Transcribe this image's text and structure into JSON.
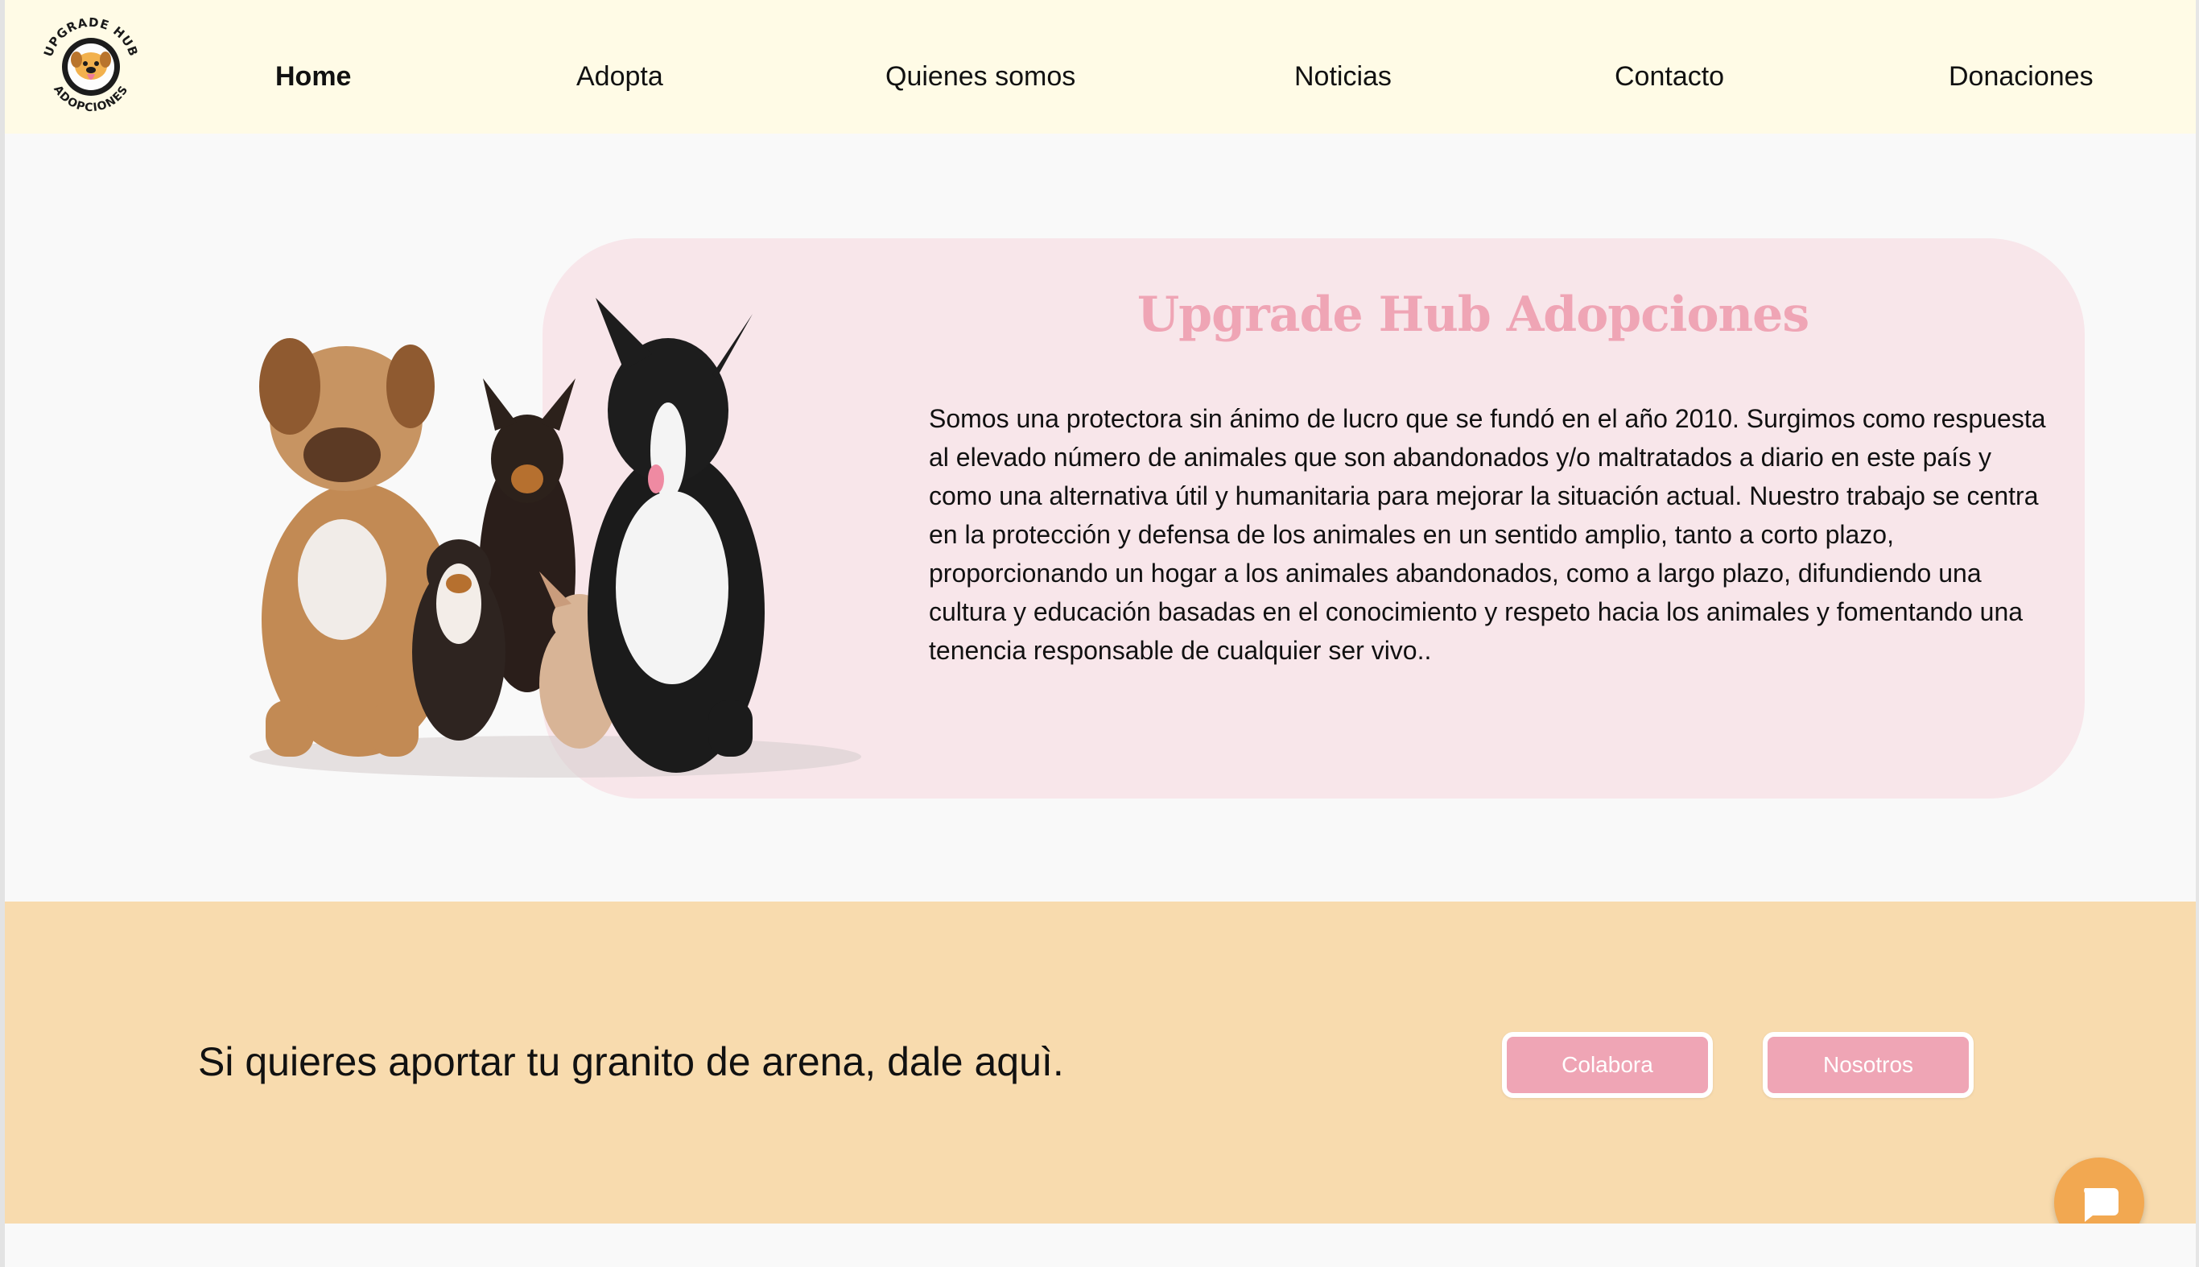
{
  "brand": {
    "logo_text_top": "UPGRADE HUB",
    "logo_text_bottom": "ADOPCIONES"
  },
  "nav": {
    "items": [
      {
        "label": "Home",
        "active": true
      },
      {
        "label": "Adopta",
        "active": false
      },
      {
        "label": "Quienes somos",
        "active": false
      },
      {
        "label": "Noticias",
        "active": false
      },
      {
        "label": "Contacto",
        "active": false
      },
      {
        "label": "Donaciones",
        "active": false
      }
    ]
  },
  "hero": {
    "title": "Upgrade Hub Adopciones",
    "body": "Somos una protectora sin ánimo de lucro que se fundó en el año 2010. Surgimos como respuesta al elevado número de animales que son abandonados y/o maltratados a diario en este país y como una alternativa útil y humanitaria para mejorar la situación actual. Nuestro trabajo se centra en la protección y defensa de los animales en un sentido amplio, tanto a corto plazo, proporcionando un hogar a los animales abandonados, como a largo plazo, difundiendo una cultura y educación basadas en el conocimiento y respeto hacia los animales y fomentando una tenencia responsable de cualquier ser vivo..",
    "image_icon": "dogs-group-photo"
  },
  "cta": {
    "text": "Si quieres aportar tu granito de arena, dale aquì.",
    "buttons": [
      {
        "label": "Colabora"
      },
      {
        "label": "Nosotros"
      }
    ]
  },
  "chat": {
    "icon": "chat-icon"
  },
  "colors": {
    "header_bg": "#fffbe6",
    "hero_card_bg": "#f8e6ea",
    "accent_pink": "#efa5b5",
    "cta_band_bg": "#f8dbae",
    "chat_orange": "#f2a851"
  }
}
